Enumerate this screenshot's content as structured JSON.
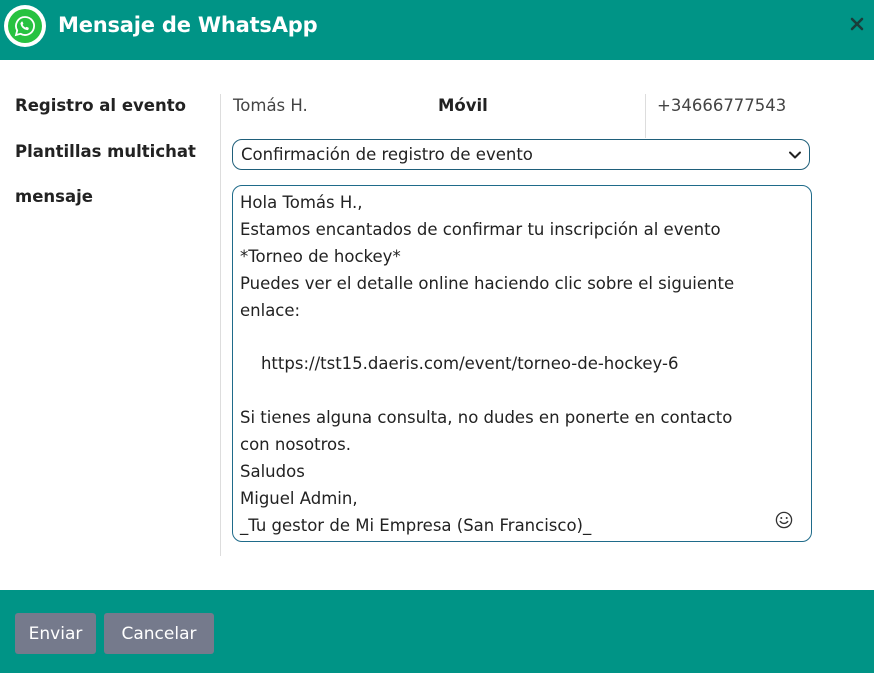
{
  "dialog": {
    "title": "Mensaje de WhatsApp",
    "icon": "whatsapp-icon",
    "close_icon": "close-icon"
  },
  "form": {
    "event_label": "Registro al evento",
    "contact_name": "Tomás H.",
    "mobile_label": "Móvil",
    "mobile_number": "+34666777543",
    "templates_label": "Plantillas multichat",
    "template_selected": "Confirmación de registro de evento",
    "message_label": "mensaje",
    "message_lines": [
      "Hola Tomás H.,",
      "Estamos encantados de confirmar tu inscripción al evento",
      "*Torneo de hockey*",
      "Puedes ver el detalle online haciendo clic sobre el siguiente",
      "enlace:",
      "",
      "    https://tst15.daeris.com/event/torneo-de-hockey-6",
      "",
      "Si tienes alguna consulta, no dudes en ponerte en contacto",
      "con nosotros.",
      "Saludos",
      "Miguel Admin,",
      "_Tu gestor de Mi Empresa (San Francisco)_"
    ],
    "emoji_icon": "smiley-icon"
  },
  "footer": {
    "send_label": "Enviar",
    "cancel_label": "Cancelar"
  },
  "colors": {
    "brand": "#009486",
    "whatsapp_green": "#27c241",
    "button": "#757a8c"
  }
}
